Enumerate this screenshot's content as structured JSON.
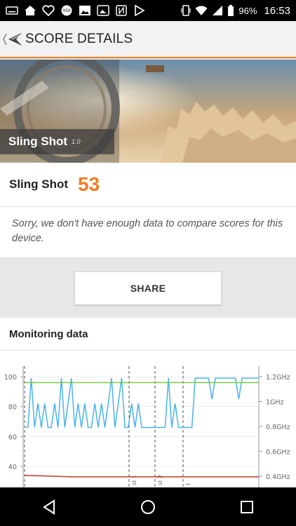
{
  "status_bar": {
    "battery_percent": "96%",
    "time": "16:53",
    "left_icons": [
      "keyboard-icon",
      "home-icon",
      "heart-icon",
      "speed-badge-icon",
      "image-icon",
      "photo-icon",
      "nfc-icon",
      "play-icon"
    ],
    "right_icons": [
      "vibrate-icon",
      "wifi-icon",
      "signal-icon",
      "battery-icon"
    ]
  },
  "header": {
    "title": "SCORE DETAILS"
  },
  "hero": {
    "test_name": "Sling Shot",
    "version": "1.0"
  },
  "score": {
    "name": "Sling Shot",
    "value": "53"
  },
  "compare_message": "Sorry, we don't have enough data to compare scores for this device.",
  "share_label": "SHARE",
  "monitoring": {
    "title": "Monitoring data"
  },
  "colors": {
    "accent": "#f07c24",
    "cpu_line": "#4ab3e8",
    "fps_line": "#7ac943",
    "temp_line": "#c0392b"
  },
  "chart_data": {
    "type": "line",
    "left_axis": {
      "ticks": [
        "100",
        "80",
        "60",
        "40"
      ]
    },
    "right_axis": {
      "ticks": [
        "1.2GHz",
        "1GHz",
        "0.8GHz",
        "0.6GHz",
        "0.4GHz"
      ]
    },
    "markers": [
      "",
      "st 1",
      "st 2",
      "t"
    ],
    "series": [
      {
        "name": "",
        "color": "#4ab3e8",
        "values": [
          66,
          66,
          99,
          66,
          82,
          66,
          82,
          66,
          66,
          82,
          66,
          99,
          66,
          82,
          99,
          66,
          82,
          66,
          82,
          66,
          66,
          82,
          66,
          82,
          66,
          82,
          99,
          66,
          82,
          99,
          66,
          66,
          82,
          66,
          82,
          66,
          66,
          66,
          66,
          66,
          66,
          66,
          66,
          99,
          66,
          82,
          66,
          66,
          66,
          66,
          66,
          99,
          99,
          99,
          99,
          99,
          85,
          99,
          99,
          99,
          99,
          99,
          99,
          99,
          85,
          99,
          99,
          99,
          99,
          99,
          99
        ]
      },
      {
        "name": "",
        "color": "#7ac943",
        "values": [
          96,
          96
        ]
      },
      {
        "name": "",
        "color": "#c0392b",
        "values": [
          34,
          33,
          33,
          33,
          33,
          33
        ]
      }
    ]
  },
  "nav": {
    "buttons": [
      "back-icon",
      "home-icon",
      "recents-icon"
    ]
  }
}
